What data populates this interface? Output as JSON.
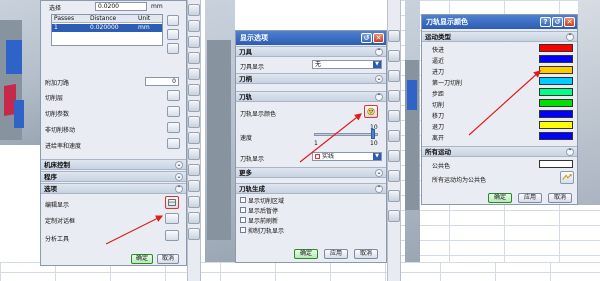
{
  "left_panel": {
    "top_field_label": "选择",
    "top_field_value": "0.0200",
    "top_field_unit": "mm",
    "table_headers": [
      "Passes",
      "Distance",
      "Unit"
    ],
    "table_rows": [
      [
        "1",
        "0.020000",
        "mm"
      ]
    ],
    "rows": [
      {
        "label": "附加刀路",
        "value": "0"
      },
      {
        "label": "切削层"
      },
      {
        "label": "切削参数"
      },
      {
        "label": "非切削移动"
      },
      {
        "label": "进给率和速度"
      }
    ],
    "sections": [
      {
        "label": "机床控制"
      },
      {
        "label": "程序"
      },
      {
        "label": "选项"
      }
    ],
    "option_rows": [
      {
        "label": "编辑显示"
      },
      {
        "label": "定制对话框"
      },
      {
        "label": "分析工具"
      }
    ],
    "ok": "确定",
    "cancel": "取消"
  },
  "middle_panel": {
    "title": "显示选项",
    "section_tool": "刀具",
    "tool_display_label": "刀具显示",
    "tool_display_value": "无",
    "section_hold": "刀柄",
    "section_path": "刀轨",
    "path_color_label": "刀轨显示颜色",
    "speed_label": "速度",
    "slider_value": "10",
    "slider_min": "1",
    "slider_max": "10",
    "path_display_label": "刀轨显示",
    "path_display_value": "实线",
    "section_more": "更多",
    "section_gen": "刀轨生成",
    "checks": [
      {
        "label": "显示切削区域"
      },
      {
        "label": "显示后暂停"
      },
      {
        "label": "显示前刷新"
      },
      {
        "label": "抑制刀轨显示"
      }
    ],
    "ok": "确定",
    "apply": "应用",
    "cancel": "取消"
  },
  "right_panel": {
    "title": "刀轨显示颜色",
    "section_motion": "运动类型",
    "motion_types": [
      {
        "label": "快进",
        "color": "#ff0000"
      },
      {
        "label": "逼近",
        "color": "#0000ff"
      },
      {
        "label": "进刀",
        "color": "#ffcc00"
      },
      {
        "label": "第一刀切削",
        "color": "#00ccff"
      },
      {
        "label": "步距",
        "color": "#00ff88"
      },
      {
        "label": "切削",
        "color": "#00dd00"
      },
      {
        "label": "移刀",
        "color": "#0000ff"
      },
      {
        "label": "退刀",
        "color": "#ffff00"
      },
      {
        "label": "离开",
        "color": "#0000ff"
      }
    ],
    "section_all": "所有运动",
    "common_color_label": "公共色",
    "all_as_common_label": "所有运动均为公共色",
    "ok": "确定",
    "apply": "应用",
    "cancel": "取消"
  },
  "icons": {
    "shuffle": "shuffle-icon",
    "edit": "edit-icon",
    "color": "color-palette-icon",
    "arrow": "red-annotation-arrow"
  },
  "accent_color": "#2c5db3",
  "annotation_color": "#e21b1b"
}
